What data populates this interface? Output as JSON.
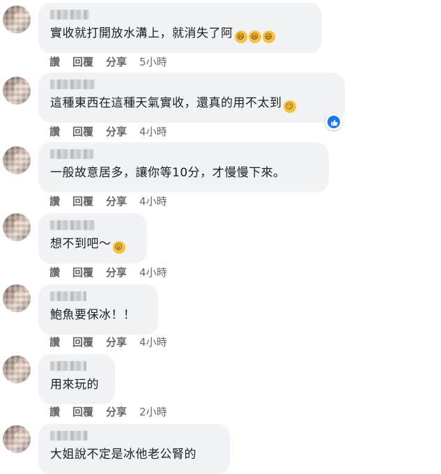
{
  "actions": {
    "like": "讚",
    "reply": "回覆",
    "share": "分享"
  },
  "comments": [
    {
      "text": "實收就打開放水溝上，就消失了阿",
      "emojis": [
        "laugh-cry-emoji",
        "laugh-cry-emoji",
        "laugh-cry-emoji"
      ],
      "time": "5小時"
    },
    {
      "text": "這種東西在這種天氣實收，還真的用不太到",
      "emojis": [
        "smirk-emoji"
      ],
      "time": "4小時",
      "liked": true
    },
    {
      "text": "一般故意居多，讓你等10分，才慢慢下來。",
      "emojis": [],
      "time": "4小時"
    },
    {
      "text": "想不到吧～",
      "emojis": [
        "tongue-emoji"
      ],
      "time": "4小時"
    },
    {
      "text": "鮑魚要保冰！！",
      "emojis": [],
      "time": "4小時"
    },
    {
      "text": "用來玩的",
      "emojis": [],
      "time": "2小時"
    },
    {
      "text": "大姐說不定是冰他老公腎的",
      "emojis": [],
      "time": ""
    }
  ],
  "colors": {
    "bubble": "#f0f2f5",
    "text": "#1c1e21",
    "meta": "#65676b",
    "like_blue": "#1877f2"
  }
}
